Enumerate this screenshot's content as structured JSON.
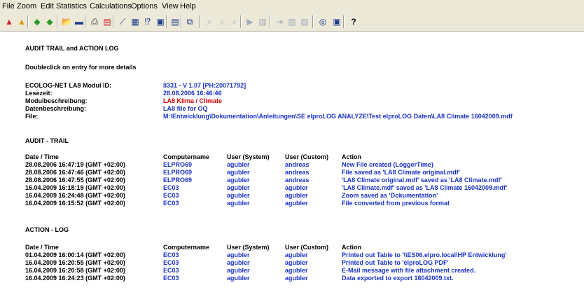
{
  "menu": [
    "File",
    "Zoom",
    "Edit",
    "Statistics",
    "Calculations",
    "Options",
    "View",
    "Help"
  ],
  "toolbar_icons": [
    "open-logger-icon",
    "open-logger-alt-icon",
    "read-logger-icon",
    "program-logger-icon",
    "open-folder-icon",
    "save-icon",
    "print-icon",
    "pdf-icon",
    "chart-icon",
    "table-icon",
    "statistics-icon",
    "info-icon",
    "document-icon",
    "copy-icon",
    "zoom-icon",
    "zoom-in-icon",
    "zoom-out-icon",
    "play-icon",
    "grid-icon",
    "export-icon",
    "chart-a-icon",
    "chart-b-icon",
    "calculator-icon",
    "window-icon",
    "help-icon"
  ],
  "report": {
    "title": "AUDIT TRAIL and ACTION LOG",
    "hint": "Doubleclick on entry for more details",
    "info": [
      {
        "label": "ECOLOG-NET LA8 Modul ID:",
        "value": "8331 - V 1.07 [PH:20071792]",
        "color": "#1a33c8"
      },
      {
        "label": "Lesezeit:",
        "value": "28.08.2006  16:46:46",
        "color": "#1a33c8"
      },
      {
        "label": "Modulbeschreibung:",
        "value": "LA8 Klima / Climate",
        "color": "#d00000"
      },
      {
        "label": "Datenbeschreibung:",
        "value": "LA8 file for OQ",
        "color": "#1a33c8"
      },
      {
        "label": "File:",
        "value": "M:\\Entwicklung\\Dokumentation\\Anleitungen\\SE elproLOG ANALYZE\\Test elproLOG Daten\\LA8 Climate 16042009.mdf",
        "color": "#1a33c8"
      }
    ],
    "audit_title": "AUDIT - TRAIL",
    "action_title": "ACTION - LOG",
    "columns": [
      "Date / Time",
      "Computername",
      "User (System)",
      "User (Custom)",
      "Action"
    ],
    "audit_rows": [
      [
        "28.08.2006  16:47:19  (GMT +02:00)",
        "ELPRO69",
        "agubler",
        "andreas",
        "New File created (LoggerTime)"
      ],
      [
        "28.08.2006  16:47:46  (GMT +02:00)",
        "ELPRO69",
        "agubler",
        "andreas",
        "File saved as 'LA8 Climate original.mdf'"
      ],
      [
        "28.08.2006  16:47:55  (GMT +02:00)",
        "ELPRO69",
        "agubler",
        "andreas",
        "'LA8 Climate original.mdf' saved as 'LA8 Climate.mdf'"
      ],
      [
        "16.04.2009  16:18:19  (GMT +02:00)",
        "EC03",
        "agubler",
        "agubler",
        "'LA8 Climate.mdf' saved as 'LA8 Climate 16042009.mdf'"
      ],
      [
        "16.04.2009  16:24:48  (GMT +02:00)",
        "EC03",
        "agubler",
        "agubler",
        "Zoom saved as 'Dokumentation'"
      ],
      [
        "16.04.2009  16:15:52  (GMT +02:00)",
        "EC03",
        "agubler",
        "agubler",
        "File converted from previous format"
      ]
    ],
    "action_rows": [
      [
        "01.04.2009  16:00:14  (GMT +02:00)",
        "EC03",
        "agubler",
        "agubler",
        "Printed out Table to '\\\\ES06.elpro.local\\HP Entwicklung'"
      ],
      [
        "16.04.2009  16:20:55  (GMT +02:00)",
        "EC03",
        "agubler",
        "agubler",
        "Printed out Table to 'elproLOG PDF'"
      ],
      [
        "16.04.2009  16:20:58  (GMT +02:00)",
        "EC03",
        "agubler",
        "agubler",
        "E-Mail message with file attachment created."
      ],
      [
        "16.04.2009  16:24:23  (GMT +02:00)",
        "EC03",
        "agubler",
        "agubler",
        "Data exported to export 16042009.txt."
      ]
    ]
  }
}
